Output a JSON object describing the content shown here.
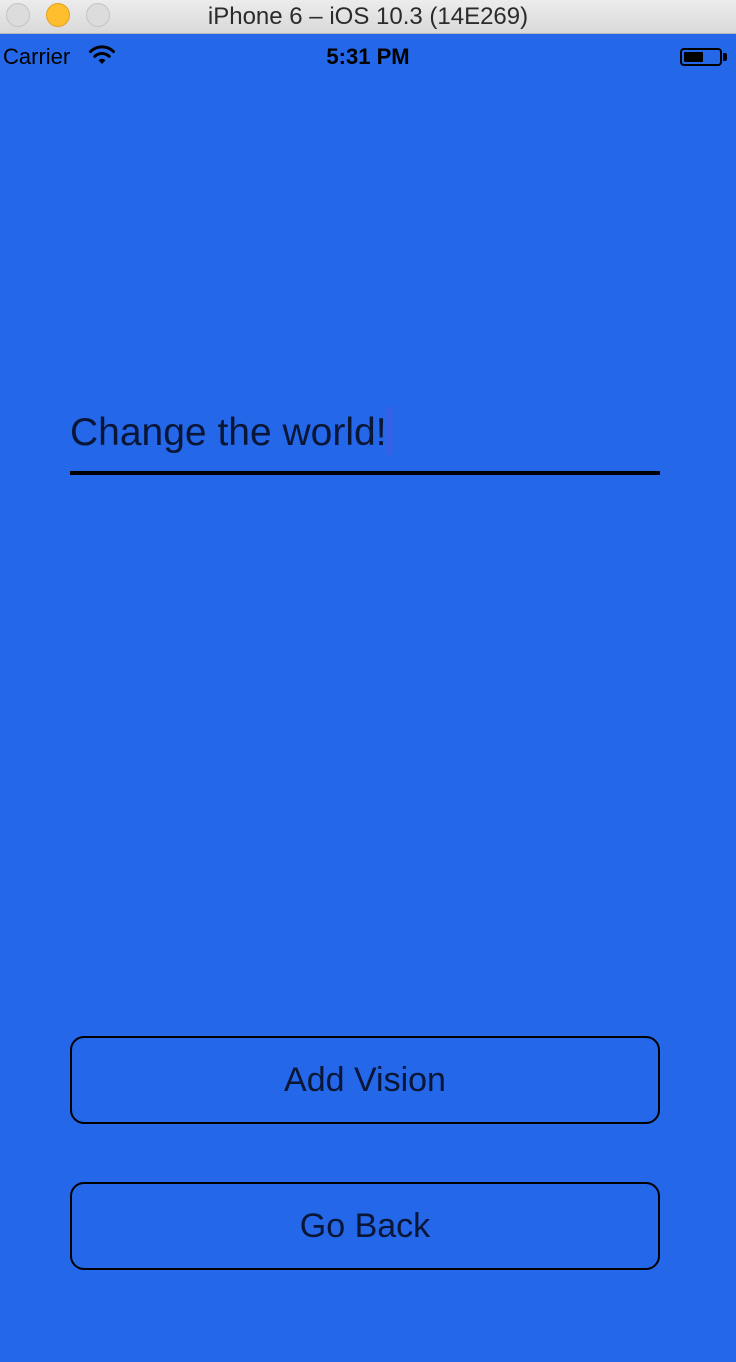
{
  "window": {
    "title": "iPhone 6 – iOS 10.3 (14E269)"
  },
  "status_bar": {
    "carrier": "Carrier",
    "time": "5:31 PM",
    "wifi_icon": "wifi-icon",
    "battery_icon": "battery-icon",
    "battery_level": 0.55
  },
  "vision_field": {
    "value": "Change the world!"
  },
  "buttons": {
    "add_vision": "Add Vision",
    "go_back": "Go Back"
  },
  "colors": {
    "background": "#2467E8",
    "text": "#0A1636",
    "caret": "#3D5CE8",
    "minimize_button": "#FEBE2E"
  }
}
